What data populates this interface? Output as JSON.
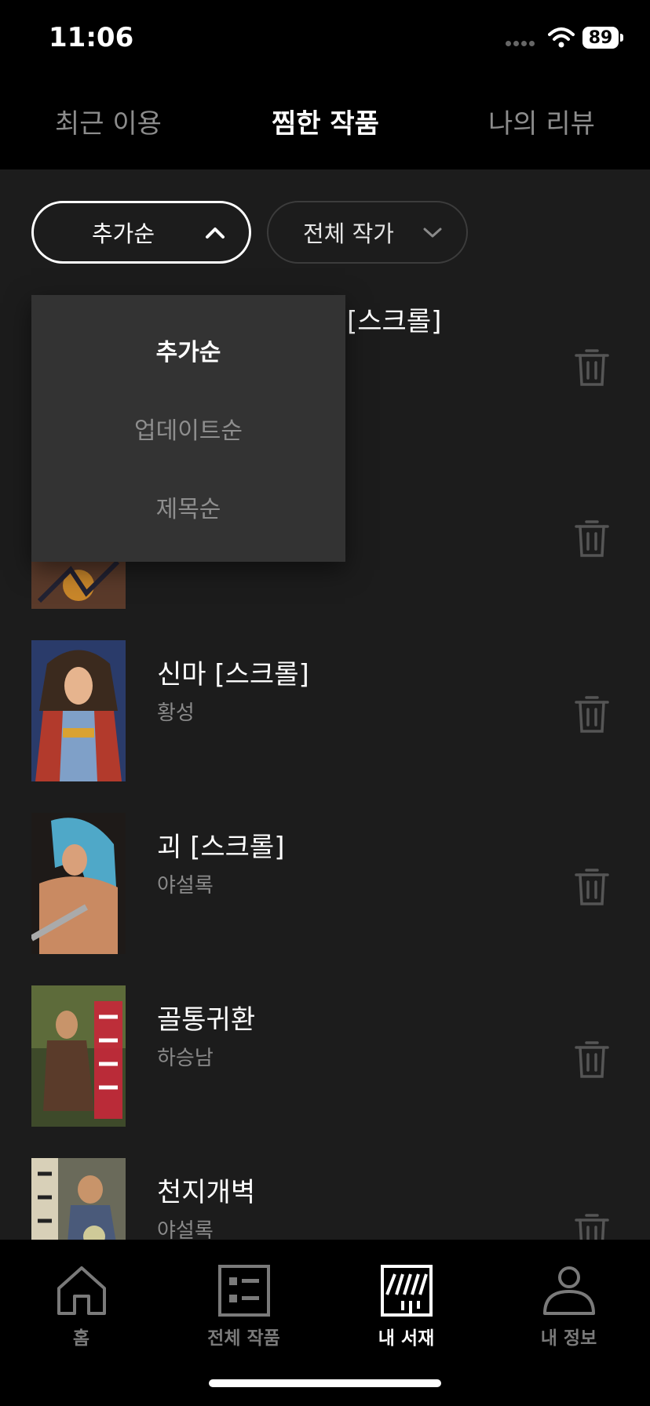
{
  "status_bar": {
    "time": "11:06",
    "battery": "89"
  },
  "top_tabs": [
    {
      "label": "최근 이용",
      "active": false
    },
    {
      "label": "찜한 작품",
      "active": true
    },
    {
      "label": "나의 리뷰",
      "active": false
    }
  ],
  "filters": {
    "sort_label": "추가순",
    "author_label": "전체 작가"
  },
  "sort_dropdown": {
    "options": [
      "추가순",
      "업데이트순",
      "제목순"
    ],
    "selected": "추가순"
  },
  "list": {
    "partial_title": "[스크롤]",
    "items": [
      {
        "title": "신마 [스크롤]",
        "author": "황성"
      },
      {
        "title": "괴 [스크롤]",
        "author": "야설록"
      },
      {
        "title": "골통귀환",
        "author": "하승남"
      },
      {
        "title": "천지개벽",
        "author": "야설록"
      }
    ]
  },
  "bottom_nav": [
    {
      "label": "홈",
      "icon": "home-icon",
      "active": false
    },
    {
      "label": "전체 작품",
      "icon": "list-icon",
      "active": false
    },
    {
      "label": "내 서재",
      "icon": "library-icon",
      "active": true
    },
    {
      "label": "내 정보",
      "icon": "person-icon",
      "active": false
    }
  ],
  "colors": {
    "background": "#1c1c1c",
    "bars": "#000000",
    "dropdown": "#333333"
  }
}
